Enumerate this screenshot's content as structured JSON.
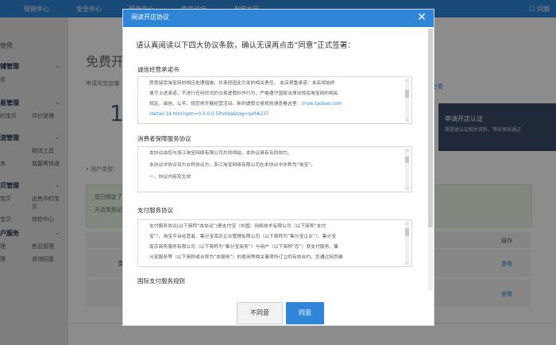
{
  "topbar": {
    "nav": [
      "规则中心",
      "安全中心",
      "服务中心",
      "卖家论坛",
      "淘宝大学"
    ],
    "right": "问题"
  },
  "sidebar": {
    "top_label": "使用",
    "groups": [
      {
        "title": "铺管理",
        "sub": [
          [
            "店",
            ""
          ]
        ]
      },
      {
        "title": "易管理",
        "sub": [
          [
            "的宝贝",
            "评价管理"
          ]
        ]
      },
      {
        "title": "流管理",
        "sub": [
          [
            "",
            "物流工具"
          ],
          [
            "务",
            "我要寄快递"
          ]
        ]
      },
      {
        "title": "贝管理",
        "sub": [
          [
            "宝贝",
            "出售中的宝贝"
          ],
          [
            "宝贝",
            "体检中心"
          ]
        ]
      },
      {
        "title": "户服务",
        "sub": [
          [
            "理",
            "售后管理"
          ],
          [
            "理",
            "咨询回复"
          ]
        ]
      }
    ]
  },
  "main": {
    "heading": "免费开",
    "tip_line": "申请淘宝店铺",
    "help_link": "必看",
    "big_number": "1",
    "right_card": {
      "title": "申请开店认证",
      "desc": "需提供认证相关资料，等待审核通过"
    },
    "user_type_label": "• 用户类型：",
    "green_box": {
      "line1": "您已绑定了",
      "line2": "开店类型必"
    },
    "table": {
      "op_header": "操作",
      "rows": [
        {
          "left": "支",
          "action": "查看"
        },
        {
          "left": "",
          "action": "查看"
        }
      ]
    }
  },
  "dialog": {
    "title": "阅读开店协议",
    "lead": "请认真阅读以下四大协议条款，确认无误再点击“同意”正式签署：",
    "sections": [
      {
        "title": "诚信经营承诺书",
        "paragraphs": [
          "愿意接受淘宝网的相应处理措施，并承担因此引发的相关责任。 本店郑重承诺：本店将始终",
          "恪守上述承诺，不进行任何形式的交易虚假炒作行为，严格遵守国家法律法规及淘宝网的相关",
          "规定，诚信、公平、规范地开展经营活动。新的虚假交易规则请查看这里：",
          "/detail-14.htm?spm=0.0.0.0.5PoVda&tag=self#237"
        ],
        "link_inline": "//rule.taobao.com"
      },
      {
        "title": "消费者保障服务协议",
        "paragraphs": [
          "本协议由您与浙江淘宝网络有限公司共同缔结，本协议具有合同效力。",
          "本协议中协议双方合称协议方，浙江淘宝网络有限公司在本协议中亦称为“淘宝”。",
          "一、协议内容及生效"
        ]
      },
      {
        "title": "支付服务协议",
        "paragraphs": [
          "支付服务协议(以下简称“本协议”)是支付宝（中国）网络技术有限公司（以下简称“支付",
          "宝”）、淘宝平台经营者、集分宝南京企业管理有限公司（以下简称为“集分宝企业”）、集分宝",
          "南京商务服务有限公司（以下简称为“集分宝商务”）与用户（以下简称“您”）就支付服务、集",
          "分宝服务等（以下简称或合称为“本服务”）的使用等相关事项所订立的有效合约。您通过网页确"
        ]
      },
      {
        "title": "国际支付服务规则",
        "paragraphs": []
      }
    ],
    "buttons": {
      "disagree": "不同意",
      "agree": "同意"
    }
  }
}
